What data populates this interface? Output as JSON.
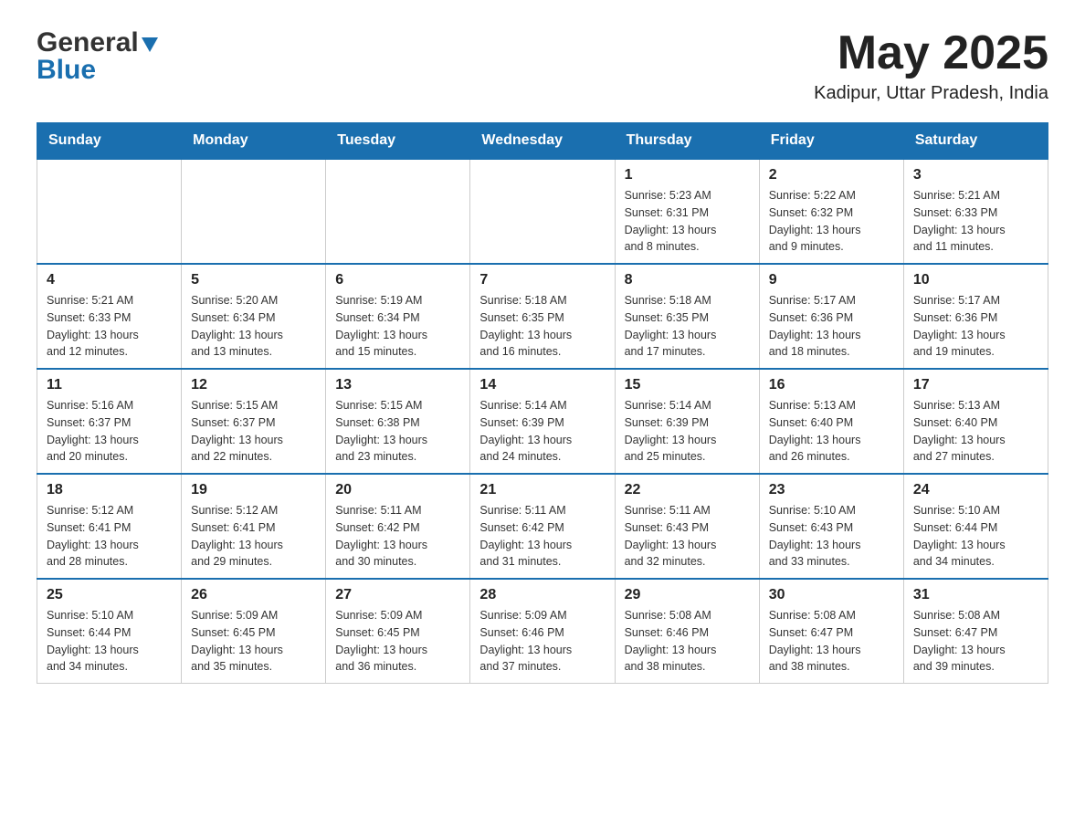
{
  "header": {
    "logo_line1": "General",
    "logo_line2": "Blue",
    "month_year": "May 2025",
    "location": "Kadipur, Uttar Pradesh, India"
  },
  "weekdays": [
    "Sunday",
    "Monday",
    "Tuesday",
    "Wednesday",
    "Thursday",
    "Friday",
    "Saturday"
  ],
  "weeks": [
    [
      {
        "day": "",
        "info": ""
      },
      {
        "day": "",
        "info": ""
      },
      {
        "day": "",
        "info": ""
      },
      {
        "day": "",
        "info": ""
      },
      {
        "day": "1",
        "info": "Sunrise: 5:23 AM\nSunset: 6:31 PM\nDaylight: 13 hours\nand 8 minutes."
      },
      {
        "day": "2",
        "info": "Sunrise: 5:22 AM\nSunset: 6:32 PM\nDaylight: 13 hours\nand 9 minutes."
      },
      {
        "day": "3",
        "info": "Sunrise: 5:21 AM\nSunset: 6:33 PM\nDaylight: 13 hours\nand 11 minutes."
      }
    ],
    [
      {
        "day": "4",
        "info": "Sunrise: 5:21 AM\nSunset: 6:33 PM\nDaylight: 13 hours\nand 12 minutes."
      },
      {
        "day": "5",
        "info": "Sunrise: 5:20 AM\nSunset: 6:34 PM\nDaylight: 13 hours\nand 13 minutes."
      },
      {
        "day": "6",
        "info": "Sunrise: 5:19 AM\nSunset: 6:34 PM\nDaylight: 13 hours\nand 15 minutes."
      },
      {
        "day": "7",
        "info": "Sunrise: 5:18 AM\nSunset: 6:35 PM\nDaylight: 13 hours\nand 16 minutes."
      },
      {
        "day": "8",
        "info": "Sunrise: 5:18 AM\nSunset: 6:35 PM\nDaylight: 13 hours\nand 17 minutes."
      },
      {
        "day": "9",
        "info": "Sunrise: 5:17 AM\nSunset: 6:36 PM\nDaylight: 13 hours\nand 18 minutes."
      },
      {
        "day": "10",
        "info": "Sunrise: 5:17 AM\nSunset: 6:36 PM\nDaylight: 13 hours\nand 19 minutes."
      }
    ],
    [
      {
        "day": "11",
        "info": "Sunrise: 5:16 AM\nSunset: 6:37 PM\nDaylight: 13 hours\nand 20 minutes."
      },
      {
        "day": "12",
        "info": "Sunrise: 5:15 AM\nSunset: 6:37 PM\nDaylight: 13 hours\nand 22 minutes."
      },
      {
        "day": "13",
        "info": "Sunrise: 5:15 AM\nSunset: 6:38 PM\nDaylight: 13 hours\nand 23 minutes."
      },
      {
        "day": "14",
        "info": "Sunrise: 5:14 AM\nSunset: 6:39 PM\nDaylight: 13 hours\nand 24 minutes."
      },
      {
        "day": "15",
        "info": "Sunrise: 5:14 AM\nSunset: 6:39 PM\nDaylight: 13 hours\nand 25 minutes."
      },
      {
        "day": "16",
        "info": "Sunrise: 5:13 AM\nSunset: 6:40 PM\nDaylight: 13 hours\nand 26 minutes."
      },
      {
        "day": "17",
        "info": "Sunrise: 5:13 AM\nSunset: 6:40 PM\nDaylight: 13 hours\nand 27 minutes."
      }
    ],
    [
      {
        "day": "18",
        "info": "Sunrise: 5:12 AM\nSunset: 6:41 PM\nDaylight: 13 hours\nand 28 minutes."
      },
      {
        "day": "19",
        "info": "Sunrise: 5:12 AM\nSunset: 6:41 PM\nDaylight: 13 hours\nand 29 minutes."
      },
      {
        "day": "20",
        "info": "Sunrise: 5:11 AM\nSunset: 6:42 PM\nDaylight: 13 hours\nand 30 minutes."
      },
      {
        "day": "21",
        "info": "Sunrise: 5:11 AM\nSunset: 6:42 PM\nDaylight: 13 hours\nand 31 minutes."
      },
      {
        "day": "22",
        "info": "Sunrise: 5:11 AM\nSunset: 6:43 PM\nDaylight: 13 hours\nand 32 minutes."
      },
      {
        "day": "23",
        "info": "Sunrise: 5:10 AM\nSunset: 6:43 PM\nDaylight: 13 hours\nand 33 minutes."
      },
      {
        "day": "24",
        "info": "Sunrise: 5:10 AM\nSunset: 6:44 PM\nDaylight: 13 hours\nand 34 minutes."
      }
    ],
    [
      {
        "day": "25",
        "info": "Sunrise: 5:10 AM\nSunset: 6:44 PM\nDaylight: 13 hours\nand 34 minutes."
      },
      {
        "day": "26",
        "info": "Sunrise: 5:09 AM\nSunset: 6:45 PM\nDaylight: 13 hours\nand 35 minutes."
      },
      {
        "day": "27",
        "info": "Sunrise: 5:09 AM\nSunset: 6:45 PM\nDaylight: 13 hours\nand 36 minutes."
      },
      {
        "day": "28",
        "info": "Sunrise: 5:09 AM\nSunset: 6:46 PM\nDaylight: 13 hours\nand 37 minutes."
      },
      {
        "day": "29",
        "info": "Sunrise: 5:08 AM\nSunset: 6:46 PM\nDaylight: 13 hours\nand 38 minutes."
      },
      {
        "day": "30",
        "info": "Sunrise: 5:08 AM\nSunset: 6:47 PM\nDaylight: 13 hours\nand 38 minutes."
      },
      {
        "day": "31",
        "info": "Sunrise: 5:08 AM\nSunset: 6:47 PM\nDaylight: 13 hours\nand 39 minutes."
      }
    ]
  ]
}
